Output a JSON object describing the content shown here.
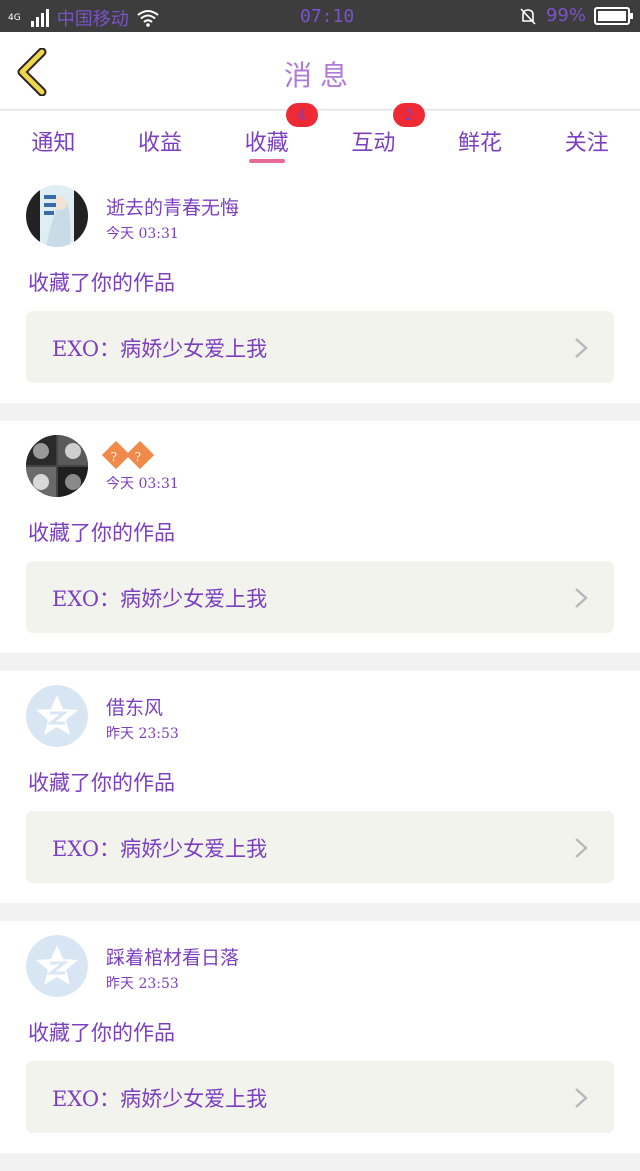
{
  "status_bar": {
    "network": "4G",
    "carrier": "中国移动",
    "time": "07:10",
    "battery": "99%",
    "battery_level": 0.99
  },
  "header": {
    "title": "消息",
    "back_icon": "chevron-left-icon"
  },
  "tabs": [
    {
      "label": "通知",
      "badge": "",
      "active": false
    },
    {
      "label": "收益",
      "badge": "",
      "active": false
    },
    {
      "label": "收藏",
      "badge": "4",
      "active": true
    },
    {
      "label": "互动",
      "badge": "2",
      "active": false
    },
    {
      "label": "鲜花",
      "badge": "",
      "active": false
    },
    {
      "label": "关注",
      "badge": "",
      "active": false
    }
  ],
  "messages": [
    {
      "user": "逝去的青春无悔",
      "time": "今天 03:31",
      "action": "收藏了你的作品",
      "work": "EXO：病娇少女爱上我",
      "avatar": "photo"
    },
    {
      "user": "??",
      "time": "今天 03:31",
      "action": "收藏了你的作品",
      "work": "EXO：病娇少女爱上我",
      "avatar": "grid-photo"
    },
    {
      "user": "借东风",
      "time": "昨天 23:53",
      "action": "收藏了你的作品",
      "work": "EXO：病娇少女爱上我",
      "avatar": "default-z"
    },
    {
      "user": "踩着棺材看日落",
      "time": "昨天 23:53",
      "action": "收藏了你的作品",
      "work": "EXO：病娇少女爱上我",
      "avatar": "default-z"
    }
  ],
  "colors": {
    "accent_purple": "#7c3fc2",
    "badge_red": "#ee2a35",
    "underline_pink": "#e86a98",
    "back_yellow": "#f2d64a"
  }
}
